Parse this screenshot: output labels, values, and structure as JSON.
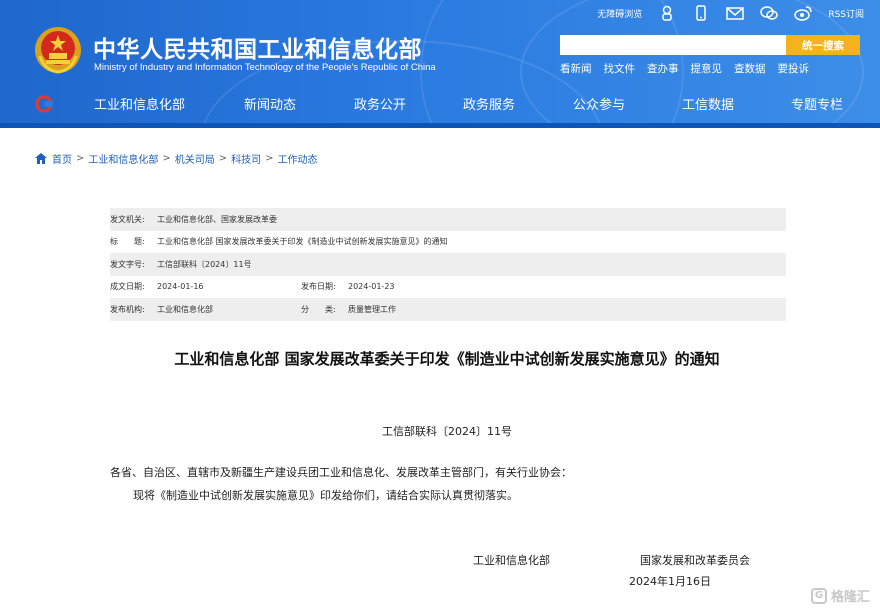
{
  "header": {
    "site_title": "中华人民共和国工业和信息化部",
    "site_subtitle": "Ministry of Industry and Information Technology of the People's Republic of China",
    "top_links": {
      "accessibility": "无障碍浏览",
      "rss": "RSS订阅"
    },
    "search": {
      "placeholder": "",
      "button": "统一搜索"
    },
    "quick_links": [
      "看新闻",
      "找文件",
      "查办事",
      "提意见",
      "查数据",
      "要投诉"
    ],
    "nav": [
      "工业和信息化部",
      "新闻动态",
      "政务公开",
      "政务服务",
      "公众参与",
      "工信数据",
      "专题专栏"
    ],
    "colors": {
      "bar": "#2a7ae0",
      "accent": "#f5b21a"
    }
  },
  "breadcrumb": [
    "首页",
    "工业和信息化部",
    "机关司局",
    "科技司",
    "工作动态"
  ],
  "meta": {
    "issuer_label": "发文机关:",
    "issuer": "工业和信息化部、国家发展改革委",
    "title_label": "标　　题:",
    "title": "工业和信息化部 国家发展改革委关于印发《制造业中试创新发展实施意见》的通知",
    "docno_label": "发文字号:",
    "docno": "工信部联科〔2024〕11号",
    "date_label": "成文日期:",
    "date": "2024-01-16",
    "pub_label": "发布日期:",
    "pub_date": "2024-01-23",
    "org_label": "发布机构:",
    "org": "工业和信息化部",
    "category_label": "分　　类:",
    "category": "质量管理工作"
  },
  "document": {
    "title": "工业和信息化部 国家发展改革委关于印发《制造业中试创新发展实施意见》的通知",
    "number": "工信部联科〔2024〕11号",
    "salutation": "各省、自治区、直辖市及新疆生产建设兵团工业和信息化、发展改革主管部门，有关行业协会：",
    "body": "现将《制造业中试创新发展实施意见》印发给你们，请结合实际认真贯彻落实。",
    "sign_1": "工业和信息化部",
    "sign_2": "国家发展和改革委员会",
    "sign_date": "2024年1月16日"
  },
  "watermark": "格隆汇"
}
